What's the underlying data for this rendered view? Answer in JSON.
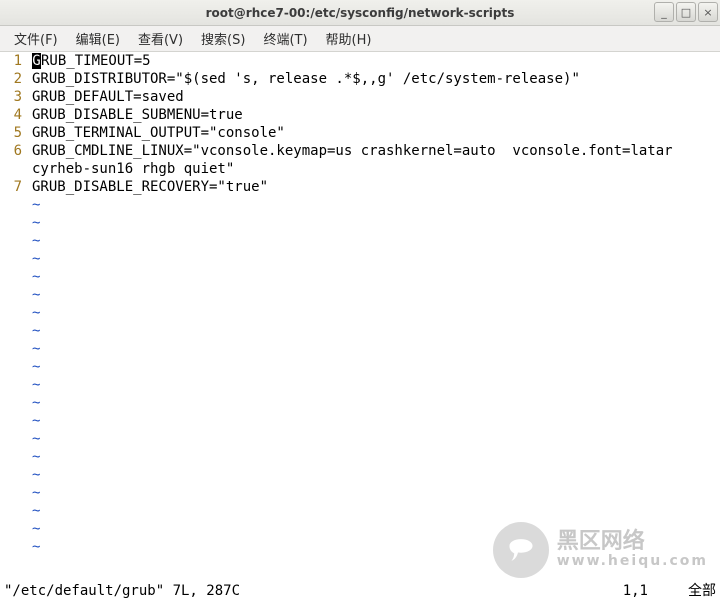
{
  "window": {
    "title": "root@rhce7-00:/etc/sysconfig/network-scripts",
    "controls": {
      "min": "_",
      "max": "□",
      "close": "×"
    }
  },
  "menubar": [
    {
      "label": "文件(F)"
    },
    {
      "label": "编辑(E)"
    },
    {
      "label": "查看(V)"
    },
    {
      "label": "搜索(S)"
    },
    {
      "label": "终端(T)"
    },
    {
      "label": "帮助(H)"
    }
  ],
  "editor": {
    "cursor_char": "G",
    "lines": [
      {
        "num": "1",
        "text": "RUB_TIMEOUT=5"
      },
      {
        "num": "2",
        "text": "GRUB_DISTRIBUTOR=\"$(sed 's, release .*$,,g' /etc/system-release)\""
      },
      {
        "num": "3",
        "text": "GRUB_DEFAULT=saved"
      },
      {
        "num": "4",
        "text": "GRUB_DISABLE_SUBMENU=true"
      },
      {
        "num": "5",
        "text": "GRUB_TERMINAL_OUTPUT=\"console\""
      },
      {
        "num": "6",
        "text": "GRUB_CMDLINE_LINUX=\"vconsole.keymap=us crashkernel=auto  vconsole.font=latar"
      },
      {
        "num": "",
        "text": "cyrheb-sun16 rhgb quiet\""
      },
      {
        "num": "7",
        "text": "GRUB_DISABLE_RECOVERY=\"true\""
      }
    ],
    "tilde": "~",
    "empty_rows": 20
  },
  "status": {
    "left": "\"/etc/default/grub\" 7L, 287C",
    "pos": "1,1",
    "scroll": "全部"
  },
  "watermark": {
    "line1": "黑区网络",
    "line2": "www.heiqu.com"
  }
}
